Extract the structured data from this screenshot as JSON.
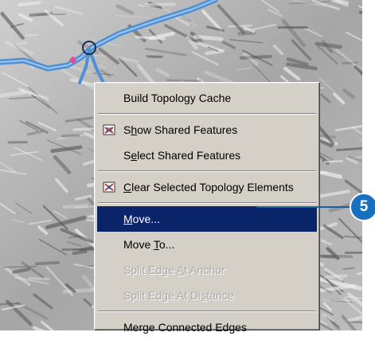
{
  "context_menu": {
    "items": [
      {
        "label": "Build Topology Cache",
        "mnemonic": "",
        "icon": null,
        "state": "normal"
      },
      {
        "separator": true
      },
      {
        "label": "Show Shared Features",
        "mnemonic": "h",
        "icon": "show-shared-features-icon",
        "state": "normal"
      },
      {
        "label": "Select Shared Features",
        "mnemonic": "e",
        "icon": null,
        "state": "normal"
      },
      {
        "separator": true
      },
      {
        "label": "Clear Selected Topology Elements",
        "mnemonic": "C",
        "icon": "clear-topology-icon",
        "state": "normal"
      },
      {
        "separator": true
      },
      {
        "label": "Move...",
        "mnemonic": "M",
        "icon": null,
        "state": "selected"
      },
      {
        "label": "Move To...",
        "mnemonic": "T",
        "icon": null,
        "state": "normal"
      },
      {
        "label": "Split Edge At Anchor",
        "mnemonic": "A",
        "icon": null,
        "state": "disabled"
      },
      {
        "label": "Split Edge At Distance",
        "mnemonic": "s",
        "icon": null,
        "state": "disabled"
      },
      {
        "separator": true
      },
      {
        "label": "Merge Connected Edges",
        "mnemonic": "g",
        "icon": null,
        "state": "normal"
      }
    ]
  },
  "callout": {
    "step_number": "5"
  },
  "colors": {
    "menu_background": "#d4d0c8",
    "selection": "#0a246a",
    "callout": "#1770bf",
    "topology_line": "#4f8fd6",
    "vertex_marker": "#e0509a"
  }
}
